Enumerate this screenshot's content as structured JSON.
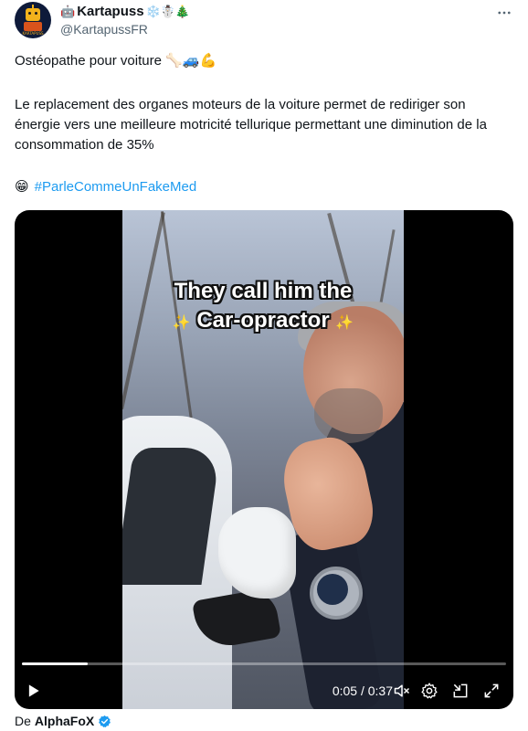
{
  "author": {
    "name": "Kartapuss",
    "name_prefix_emoji": "🤖",
    "name_suffix_emojis": "❄️☃️🎄",
    "handle": "@KartapussFR",
    "avatar_caption": "KARTAPUSS"
  },
  "tweet": {
    "line1": "Ostéopathe pour voiture 🦴🚙💪",
    "paragraph": "Le replacement des organes moteurs de la voiture permet de rediriger son énergie  vers une meilleure motricité tellurique permettant une diminution de la consommation de 35%",
    "hashtag_emoji": "😁",
    "hashtag": "#ParleCommeUnFakeMed"
  },
  "video": {
    "caption_line1": "They call him the",
    "caption_line2": "Car-opractor",
    "sparkle": "✨",
    "time_display": "0:05 / 0:37",
    "progress_fraction": 0.135
  },
  "footer": {
    "prefix": "De",
    "source": "AlphaFoX"
  },
  "icons": {
    "more": "more-dots-icon",
    "play": "play-icon",
    "mute": "mute-icon",
    "settings": "settings-gear-icon",
    "minimize": "minimize-icon",
    "fullscreen": "fullscreen-icon",
    "verified": "verified-badge-icon"
  },
  "colors": {
    "link": "#1d9bf0",
    "text": "#0f1419",
    "secondary": "#536471",
    "verified": "#1d9bf0"
  }
}
